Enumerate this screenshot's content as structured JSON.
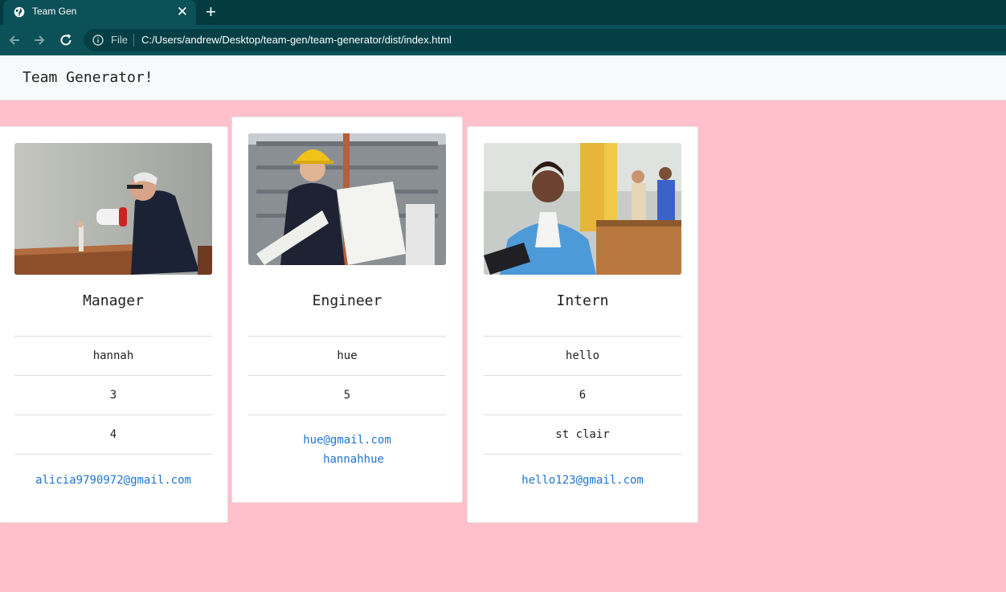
{
  "browser": {
    "tab_title": "Team Gen",
    "close_glyph": "✕",
    "newtab_glyph": "+",
    "file_label": "File",
    "url": "C:/Users/andrew/Desktop/team-gen/team-generator/dist/index.html"
  },
  "page": {
    "brand": "Team Generator!",
    "background_color": "#ffc0cb"
  },
  "cards": [
    {
      "role": "Manager",
      "photo": "manager-with-megaphone-photo",
      "rows": [
        "hannah",
        "3",
        "4"
      ],
      "email": "alicia9790972@gmail.com"
    },
    {
      "role": "Engineer",
      "photo": "engineer-with-blueprint-photo",
      "rows": [
        "hue",
        "5"
      ],
      "email": "hue@gmail.com",
      "github": "hannahhue"
    },
    {
      "role": "Intern",
      "photo": "intern-smiling-photo",
      "rows": [
        "hello",
        "6",
        "st clair"
      ],
      "email": "hello123@gmail.com"
    }
  ]
}
